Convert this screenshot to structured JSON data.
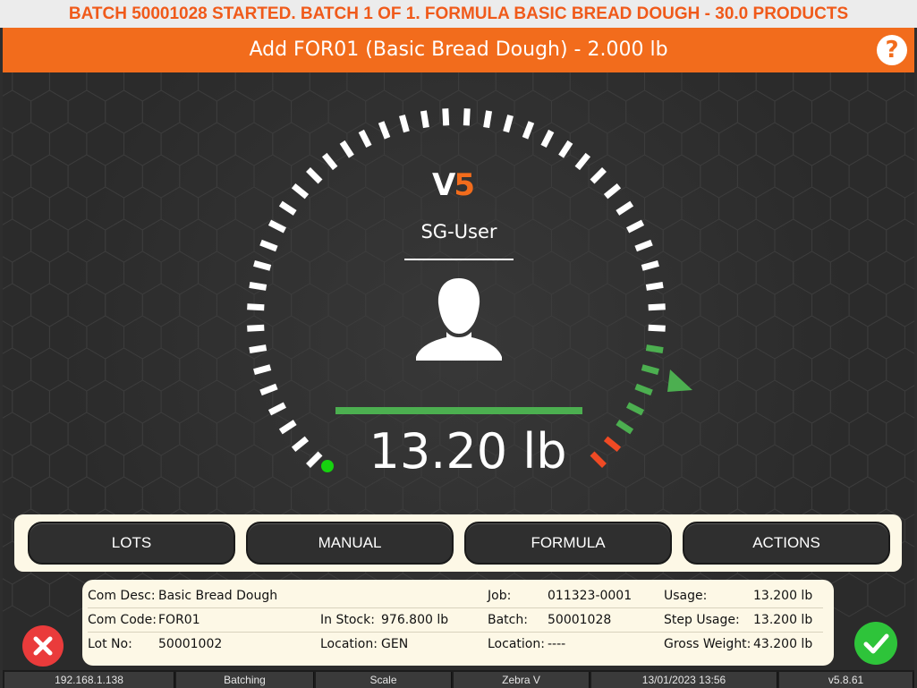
{
  "banner": "BATCH 50001028 STARTED. BATCH 1 OF 1. FORMULA BASIC BREAD DOUGH - 30.0 PRODUCTS",
  "title": "Add FOR01 (Basic Bread Dough) - 2.000 lb",
  "help_label": "?",
  "logo": {
    "v": "V",
    "five": "5"
  },
  "user": {
    "name": "SG-User"
  },
  "scale": {
    "weight_display": "13.20 lb"
  },
  "buttons": {
    "lots": "LOTS",
    "manual": "MANUAL",
    "formula": "FORMULA",
    "actions": "ACTIONS"
  },
  "info": {
    "com_desc_label": "Com Desc:",
    "com_desc": "Basic Bread Dough",
    "com_code_label": "Com Code:",
    "com_code": "FOR01",
    "lot_no_label": "Lot No:",
    "lot_no": "50001002",
    "in_stock_label": "In Stock:",
    "in_stock": "976.800 lb",
    "location_label": "Location:",
    "location": "GEN",
    "job_label": "Job:",
    "job": "011323-0001",
    "batch_label": "Batch:",
    "batch": "50001028",
    "location2_label": "Location:",
    "location2": "----",
    "usage_label": "Usage:",
    "usage": "13.200 lb",
    "step_usage_label": "Step Usage:",
    "step_usage": "13.200 lb",
    "gross_weight_label": "Gross Weight:",
    "gross_weight": "43.200 lb"
  },
  "status_bar": {
    "ip": "192.168.1.138",
    "mode": "Batching",
    "device": "Scale",
    "printer": "Zebra V",
    "datetime": "13/01/2023 13:56",
    "version": "v5.8.61"
  },
  "colors": {
    "accent": "#f26c1c",
    "tolerance_green": "#4caf50",
    "over_red": "#ef4a24",
    "confirm": "#2ec43a",
    "cancel": "#ea3b3b"
  },
  "icons": {
    "help": "help-icon",
    "user": "user-icon",
    "cancel": "close-icon",
    "confirm": "check-icon",
    "target": "target-arrow-icon",
    "zero": "zero-indicator-icon"
  }
}
